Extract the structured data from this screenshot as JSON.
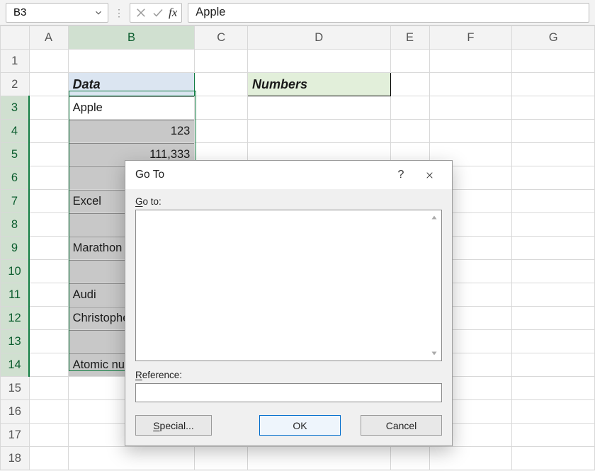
{
  "namebox": {
    "ref": "B3"
  },
  "formula_bar": {
    "value": "Apple"
  },
  "columns": [
    "A",
    "B",
    "C",
    "D",
    "E",
    "F",
    "G"
  ],
  "col_widths": {
    "rowhdr": 41,
    "A": 56,
    "B": 180,
    "C": 76,
    "D": 204,
    "E": 56,
    "F": 119,
    "G": 119
  },
  "rows": [
    "1",
    "2",
    "3",
    "4",
    "5",
    "6",
    "7",
    "8",
    "9",
    "10",
    "11",
    "12",
    "13",
    "14",
    "15",
    "16",
    "17",
    "18"
  ],
  "selected_col": "B",
  "cells": {
    "B2": {
      "text": "Data",
      "header": "data"
    },
    "D2": {
      "text": "Numbers",
      "header": "num"
    },
    "B3": {
      "text": "Apple",
      "active": true
    },
    "B4": {
      "text": "123",
      "align": "right"
    },
    "B5": {
      "text": "111,333",
      "align": "right"
    },
    "B6": {
      "text": ""
    },
    "B7": {
      "text": "Excel"
    },
    "B8": {
      "text": ""
    },
    "B9": {
      "text": "Marathon"
    },
    "B10": {
      "text": ""
    },
    "B11": {
      "text": "Audi"
    },
    "B12": {
      "text": "Christopher"
    },
    "B13": {
      "text": ""
    },
    "B14": {
      "text": "Atomic number"
    }
  },
  "selection": {
    "col": "B",
    "from": 3,
    "to": 14
  },
  "dialog": {
    "title": "Go To",
    "goto_label": "Go to:",
    "reference_label": "Reference:",
    "reference_value": "",
    "buttons": {
      "special": "Special...",
      "ok": "OK",
      "cancel": "Cancel"
    }
  }
}
